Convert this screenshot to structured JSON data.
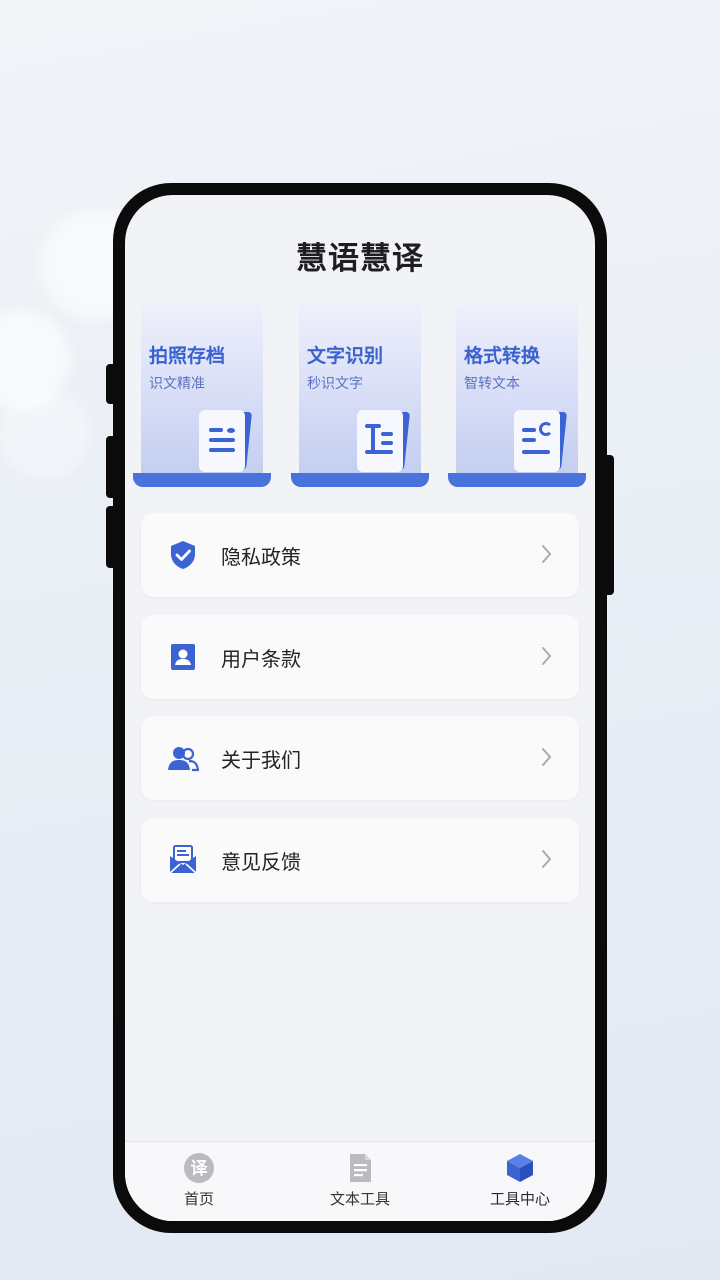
{
  "app_title": "慧语慧译",
  "feature_cards": [
    {
      "title": "拍照存档",
      "subtitle": "识文精准",
      "icon": "document-lines-icon"
    },
    {
      "title": "文字识别",
      "subtitle": "秒识文字",
      "icon": "text-recognition-icon"
    },
    {
      "title": "格式转换",
      "subtitle": "智转文本",
      "icon": "format-convert-icon"
    }
  ],
  "menu_items": [
    {
      "label": "隐私政策",
      "icon": "shield-check-icon"
    },
    {
      "label": "用户条款",
      "icon": "user-card-icon"
    },
    {
      "label": "关于我们",
      "icon": "users-icon"
    },
    {
      "label": "意见反馈",
      "icon": "mail-icon"
    }
  ],
  "tabs": [
    {
      "label": "首页",
      "icon": "translate-icon",
      "icon_char": "译",
      "active": false
    },
    {
      "label": "文本工具",
      "icon": "document-icon",
      "active": false
    },
    {
      "label": "工具中心",
      "icon": "cube-icon",
      "active": true
    }
  ],
  "colors": {
    "accent": "#3c63d4",
    "card_title": "#3a62cf"
  }
}
